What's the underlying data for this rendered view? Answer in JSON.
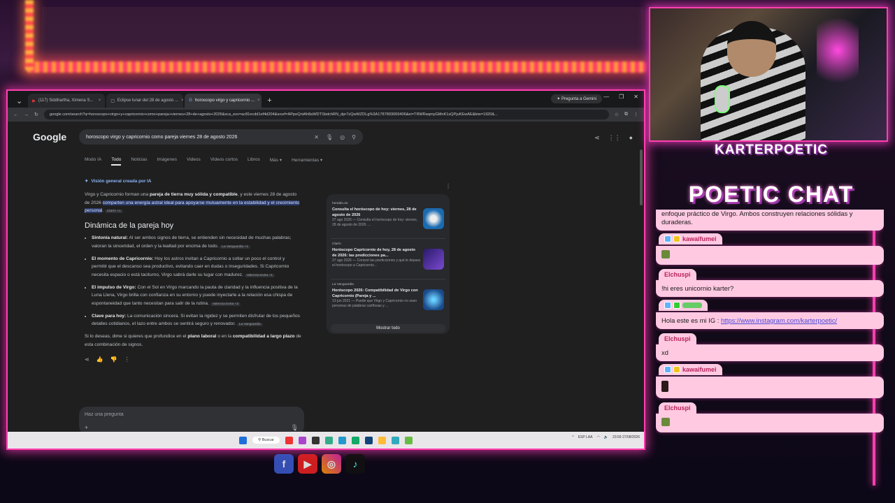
{
  "browser": {
    "tabs": [
      {
        "label": "(117) Siddhartha, Ximena S..."
      },
      {
        "label": "Eclipse lunar del 28 de agosto ..."
      },
      {
        "label": "horoscopo virgo y capricornio ..."
      }
    ],
    "gemini_button": "Pregunta a Gemini",
    "url": "google.com/search?q=horoscopo+virgo+y+capricornio+como+pareja+viernes+28+de+agosto+2026&sca_esv=ac81ecdd1ef4d204&sxsrf=APpeQntAh8aWDTSbdchRN_dpr7zQwWZDLg%3A1787893069406&ei=TRWRaqmyGMnK1sQPjuKEwAE&biw=1920&..."
  },
  "google": {
    "logo": "Google",
    "query": "horoscopo virgo y capricornio como pareja viernes 28 de agosto 2026",
    "nav": [
      "Modo IA",
      "Todo",
      "Noticias",
      "Imágenes",
      "Videos",
      "Videos cortos",
      "Libros",
      "Más ▾",
      "Herramientas ▾"
    ],
    "ai_header": "Visión general creada por IA",
    "intro_a": "Virgo y Capricornio forman una ",
    "intro_b": "pareja de tierra muy sólida y compatible",
    "intro_c": ", y este viernes 28 de agosto de 2026 ",
    "intro_hl": "comparten una energía astral ideal para apoyarse mutuamente en la estabilidad y el crecimiento personal",
    "intro_src": "Clarín +1",
    "heading": "Dinámica de la pareja hoy",
    "bullets": [
      {
        "title": "Sintonía natural:",
        "text": " Al ser ambos signos de tierra, se entienden sin necesidad de muchas palabras; valoran la sinceridad, el orden y la lealtad por encima de todo.",
        "src": "La Vanguardia +1"
      },
      {
        "title": "El momento de Capricornio:",
        "text": " Hoy los astros invitan a Capricornio a soltar un poco el control y permitir que el descanso sea productivo, evitando caer en dudas o inseguridades. Si Capricornio necesita espacio o está taciturno, Virgo sabrá darle su lugar con madurez.",
        "src": "Valencia Extra +1"
      },
      {
        "title": "El impulso de Virgo:",
        "text": " Con el Sol en Virgo marcando la pauta de claridad y la influencia positiva de la Luna Llena, Virgo brilla con confianza en su entorno y puede inyectarle a la relación esa chispa de espontaneidad que tanto necesitan para salir de la rutina.",
        "src": "Valencia Extra +2"
      },
      {
        "title": "Clave para hoy:",
        "text": " La comunicación sincera. Si evitan la rigidez y se permiten disfrutar de los pequeños detalles cotidianos, el lazo entre ambos se sentirá seguro y renovador.",
        "src": "La Vanguardia"
      }
    ],
    "outro_a": "Si lo deseas, dime si quieres que profundice en el ",
    "outro_b": "plano laboral",
    "outro_c": " o en la ",
    "outro_d": "compatibilidad a largo plazo",
    "outro_e": " de esta combinación de signos.",
    "ask_placeholder": "Haz una pregunta",
    "sources": [
      {
        "pub": "heraldo.es",
        "title": "Consulta el horóscopo de hoy: viernes, 28 de agosto de 2026",
        "snippet": "27 ago 2026 — Consulta el horóscopo de hoy: viernes, 28 de agosto de 2026. ...",
        "color": "#1a6ab0"
      },
      {
        "pub": "Clarín",
        "title": "Horóscopo Capricornio de hoy, 28 de agosto de 2026: las predicciones pa...",
        "snippet": "27 ago 2026 — Conocé las predicciones y qué le depara el horóscopo a Capricornio...",
        "color": "#3a2a8a"
      },
      {
        "pub": "La Vanguardia",
        "title": "Horóscopo 2026: Compatibilidad de Virgo con Capricornio (Pareja y ...",
        "snippet": "13 jun 2021 — Puede que Virgo y Capricornio no sean personas de palabras cariñosas y ...",
        "color": "#2a8ab0"
      }
    ],
    "show_all": "Mostrar todo"
  },
  "taskbar": {
    "search": "Buscar",
    "lang": "ESP LAA",
    "time": "23:59",
    "date": "27/08/2026"
  },
  "stream": {
    "handle": "KARTERPOETIC",
    "chat_title": "POETIC CHAT"
  },
  "chat": {
    "partial": "enfoque práctico de Virgo. Ambos construyen relaciones sólidas y duraderas.",
    "messages": [
      {
        "user": "kawaifumei",
        "text": ""
      },
      {
        "user": "Elchuspi",
        "text": "!hi eres unicornio karter?"
      },
      {
        "user": "",
        "text": "Hola este es mi IG : ",
        "link": "https://www.instagram.com/karterpoetic/"
      },
      {
        "user": "Elchuspi",
        "text": "xd"
      },
      {
        "user": "kawaifumei",
        "text": ""
      },
      {
        "user": "Elchuspi",
        "text": ""
      }
    ]
  },
  "colors": {
    "neon": "#ff3fb0",
    "chat_bg": "#ffc9e2",
    "chat_name": "#b8235a",
    "link": "#4a49d8"
  }
}
